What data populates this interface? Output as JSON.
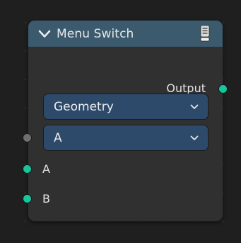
{
  "node": {
    "title": "Menu Switch",
    "header_color": "#3b5a6e",
    "body_color": "#303030",
    "collapse_icon": "chevron-down-icon",
    "preview_icon": "node-preview-icon",
    "outputs": [
      {
        "label": "Output",
        "socket_color": "#17c69c"
      }
    ],
    "type_dropdown": {
      "value": "Geometry"
    },
    "menu_input": {
      "value": "A",
      "socket_color": "#6f6f6f"
    },
    "inputs": [
      {
        "label": "A",
        "socket_color": "#17c69c"
      },
      {
        "label": "B",
        "socket_color": "#17c69c"
      }
    ]
  },
  "colors": {
    "canvas": "#1f1f1f",
    "dropdown": "#2e4a6b",
    "geometry_socket": "#17c69c",
    "menu_socket": "#6f6f6f"
  }
}
